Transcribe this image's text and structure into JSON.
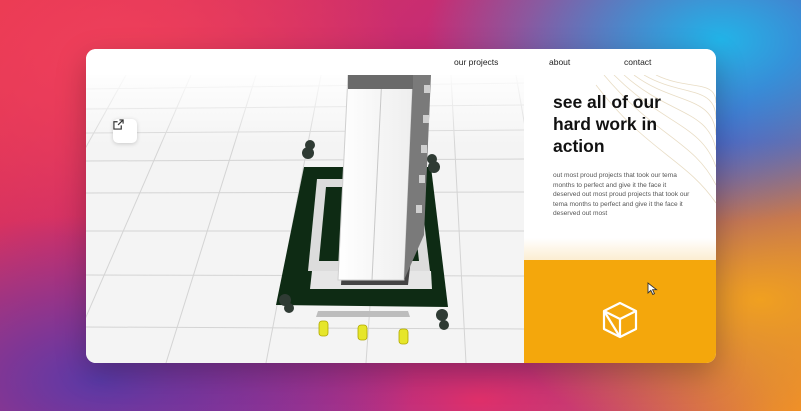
{
  "nav": {
    "links": [
      {
        "label": "our projects"
      },
      {
        "label": "about"
      },
      {
        "label": "contact"
      }
    ]
  },
  "viewer": {
    "open_external_icon": "external-link-icon"
  },
  "info": {
    "heading": "see all of our hard work in action",
    "description": "out most proud projects that took our tema months to perfect and give it the face it deserved out most proud projects that took our tema months to perfect and give it the face it deserved out most"
  },
  "cta": {
    "icon": "3d-box-icon",
    "cursor": "cursor-icon",
    "color": "#f4a70c"
  }
}
